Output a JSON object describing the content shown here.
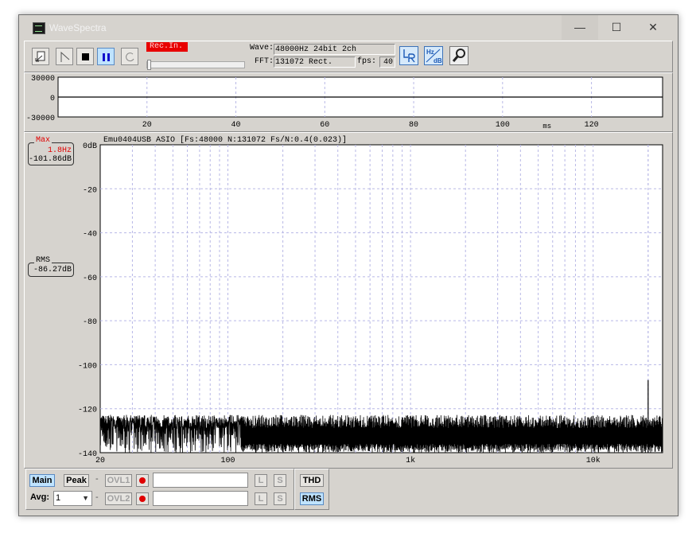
{
  "window": {
    "title": "WaveSpectra",
    "minimize_glyph": "—",
    "maximize_glyph": "☐",
    "close_glyph": "✕"
  },
  "toolbar": {
    "rec_in_label": "Rec.In.",
    "wave_label": "Wave:",
    "wave_value": "48000Hz 24bit 2ch",
    "fft_label": "FFT:",
    "fft_value": "131072 Rect.",
    "fps_label": "fps:",
    "fps_value": "40",
    "icons": [
      "open-file-icon",
      "play-marker-icon",
      "stop-icon",
      "pause-icon",
      "loop-icon",
      "lr-channel-icon",
      "hz-db-scale-icon",
      "settings-wrench-icon"
    ]
  },
  "status_lines": {
    "max_caption": "Max",
    "max_freq": "1.8Hz",
    "max_level": "-101.86dB",
    "rms_caption": "RMS",
    "rms_level": "-86.27dB"
  },
  "chart_data": [
    {
      "type": "line",
      "name": "waveform",
      "ylim": [
        -30000,
        30000
      ],
      "yticks": [
        "30000",
        "0",
        "-30000"
      ],
      "xlim": [
        0,
        136
      ],
      "xticks": [
        20,
        40,
        60,
        80,
        100,
        120
      ],
      "xunit": "ms",
      "series": [
        {
          "x": [
            0,
            136
          ],
          "y": [
            0,
            0
          ]
        }
      ],
      "grid": true
    },
    {
      "type": "line",
      "name": "spectrum",
      "title": "Emu0404USB ASIO  [Fs:48000 N:131072 Fs/N:0.4(0.023)]",
      "x_scale": "log",
      "xlim": [
        20,
        24000
      ],
      "xtick_labels": [
        {
          "value": 20,
          "label": "20"
        },
        {
          "value": 100,
          "label": "100"
        },
        {
          "value": 1000,
          "label": "1k"
        },
        {
          "value": 10000,
          "label": "10k"
        }
      ],
      "ylim": [
        -140,
        0
      ],
      "yticks": [
        "0dB",
        "-20",
        "-40",
        "-60",
        "-80",
        "-100",
        "-120",
        "-140"
      ],
      "noise_floor_db": [
        -125,
        -140
      ],
      "peak": {
        "freq": 20000,
        "db": -107
      },
      "grid": true,
      "line_color": "#000000"
    }
  ],
  "bottom": {
    "main": "Main",
    "peak": "Peak",
    "avg_label": "Avg:",
    "avg_value": "1",
    "ovl1": "OVL1",
    "ovl2": "OVL2",
    "dash": "-",
    "l": "L",
    "s": "S",
    "thd": "THD",
    "rms": "RMS"
  }
}
